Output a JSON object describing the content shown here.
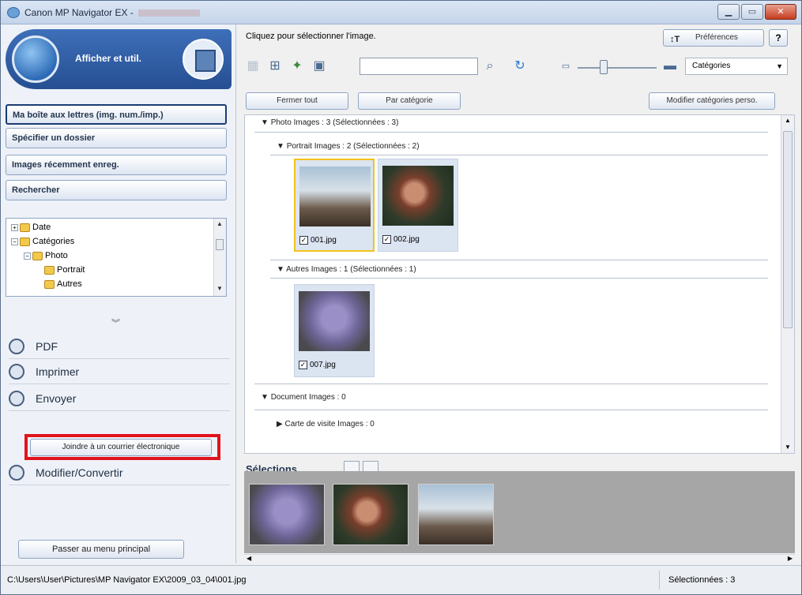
{
  "window": {
    "title": "Canon MP Navigator EX -"
  },
  "left": {
    "mode_label": "Afficher et util.",
    "nav": [
      "Ma boîte aux lettres (img. num./imp.)",
      "Spécifier un dossier",
      "Images récemment enreg.",
      "Rechercher"
    ],
    "tree": [
      "Date",
      "Catégories",
      "Photo",
      "Portrait",
      "Autres"
    ],
    "actions": [
      "PDF",
      "Imprimer",
      "Envoyer",
      "Modifier/Convertir"
    ],
    "attach_label": "Joindre à un courrier électronique",
    "main_menu_label": "Passer au menu principal"
  },
  "right": {
    "instruction": "Cliquez pour sélectionner l'image.",
    "preferences": "Préférences",
    "help": "?",
    "search_value": "",
    "view_mode": "Catégories",
    "close_all": "Fermer tout",
    "by_category": "Par catégorie",
    "edit_categories": "Modifier catégories perso.",
    "sections": [
      "Photo   Images : 3   (Sélectionnées : 3)",
      "Portrait   Images : 2   (Sélectionnées : 2)",
      "Autres   Images : 1   (Sélectionnées : 1)",
      "Document   Images : 0",
      "Carte de visite   Images : 0"
    ],
    "thumbs": [
      "001.jpg",
      "002.jpg",
      "007.jpg"
    ],
    "selections_title": "Sélections"
  },
  "status": {
    "path": "C:\\Users\\User\\Pictures\\MP Navigator EX\\2009_03_04\\001.jpg",
    "selected": "Sélectionnées : 3"
  },
  "colors": {
    "accent": "#2d5aa3",
    "highlight": "#e0141c",
    "selected_border": "#f2c21b"
  }
}
